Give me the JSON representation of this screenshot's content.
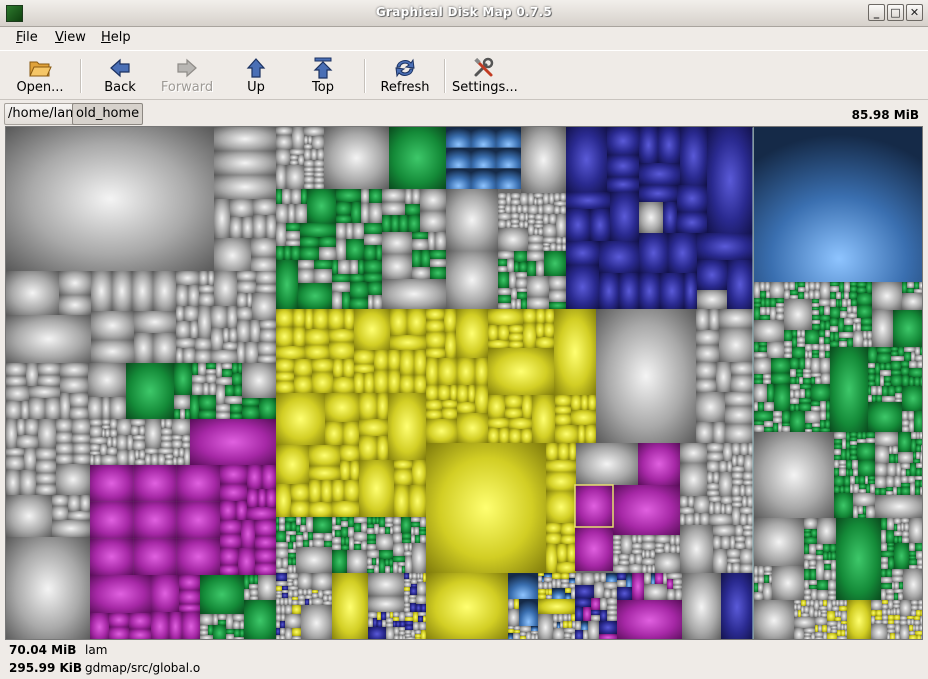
{
  "window": {
    "title": "Graphical Disk Map 0.7.5"
  },
  "menubar": {
    "items": [
      {
        "label": "File",
        "mnemonic": "F",
        "rest": "ile"
      },
      {
        "label": "View",
        "mnemonic": "V",
        "rest": "iew"
      },
      {
        "label": "Help",
        "mnemonic": "H",
        "rest": "elp"
      }
    ]
  },
  "toolbar": {
    "open": "Open...",
    "back": "Back",
    "forward": "Forward",
    "up": "Up",
    "top": "Top",
    "refresh": "Refresh",
    "settings": "Settings..."
  },
  "pathbar": {
    "segments": [
      "/home/lam",
      "old_home"
    ],
    "total_size": "85.98 MiB"
  },
  "status": {
    "dir_size": "70.04 MiB",
    "dir_name": "lam",
    "file_size": "295.99 KiB",
    "file_path": "gdmap/src/global.o"
  },
  "colors": {
    "gray": "#b4b4b4",
    "green": "#1f8f3a",
    "yellow": "#d6d22a",
    "purple": "#a02aa0",
    "navy": "#2a2a8a",
    "lightblue": "#5a8fcf",
    "selection": "#e8e070"
  },
  "icons": {
    "open": "folder-open-icon",
    "back": "arrow-left-icon",
    "forward": "arrow-right-icon",
    "up": "arrow-up-icon",
    "top": "arrow-top-icon",
    "refresh": "refresh-icon",
    "settings": "tools-icon"
  }
}
